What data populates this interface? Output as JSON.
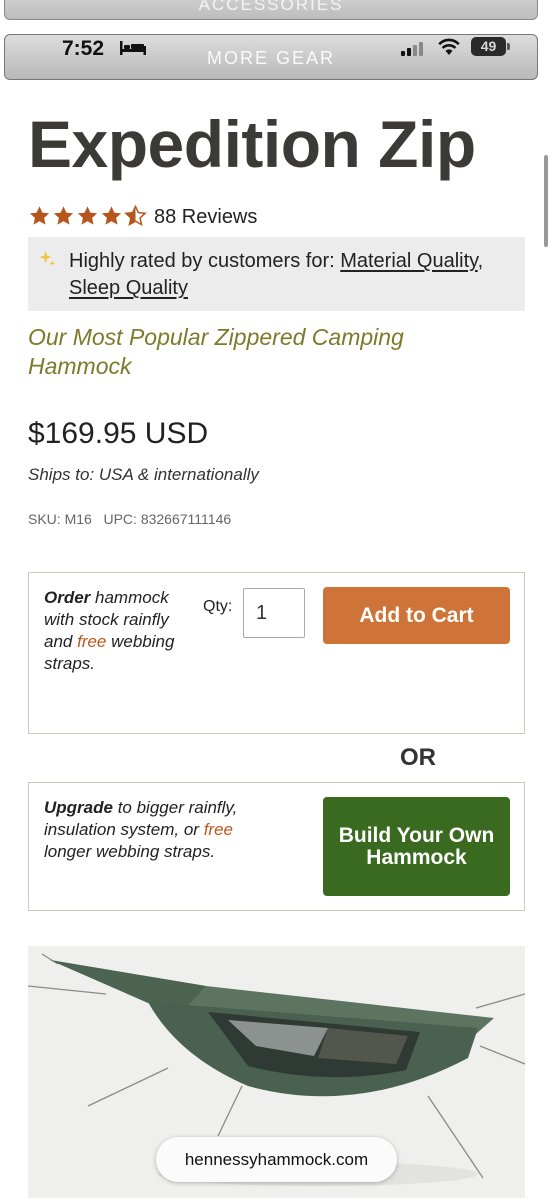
{
  "status_bar": {
    "time": "7:52",
    "battery": "49"
  },
  "nav": {
    "top_ghost_label": "ACCESSORIES",
    "label": "MORE GEAR"
  },
  "product": {
    "title": "Expedition Zip",
    "rating": 4.5,
    "reviews": "88 Reviews",
    "rated_prefix": "Highly rated by customers for: ",
    "rated_tags": [
      "Material Quality",
      "Sleep Quality"
    ],
    "subtitle": "Our Most Popular Zippered Camping Hammock",
    "price": "$169.95 USD",
    "ships": "Ships to: USA & internationally",
    "sku": "SKU: M16",
    "upc": "UPC: 832667111146"
  },
  "order_box": {
    "lead": "Order",
    "text_1": " hammock with stock rainfly and ",
    "free": "free",
    "text_2": " webbing straps.",
    "qty_label": "Qty:",
    "qty_value": "1",
    "add_to_cart": "Add to Cart"
  },
  "or_label": "OR",
  "upgrade_box": {
    "lead": "Upgrade",
    "text_1": " to bigger rainfly, insulation system, or ",
    "free": "free",
    "text_2": " longer webbing straps.",
    "build_button": "Build Your Own Hammock"
  },
  "url_pill": "hennessyhammock.com",
  "colors": {
    "accent_orange": "#cf7439",
    "accent_green": "#3a6a1f",
    "subtitle_olive": "#7d7a2a",
    "star": "#b5561d"
  }
}
